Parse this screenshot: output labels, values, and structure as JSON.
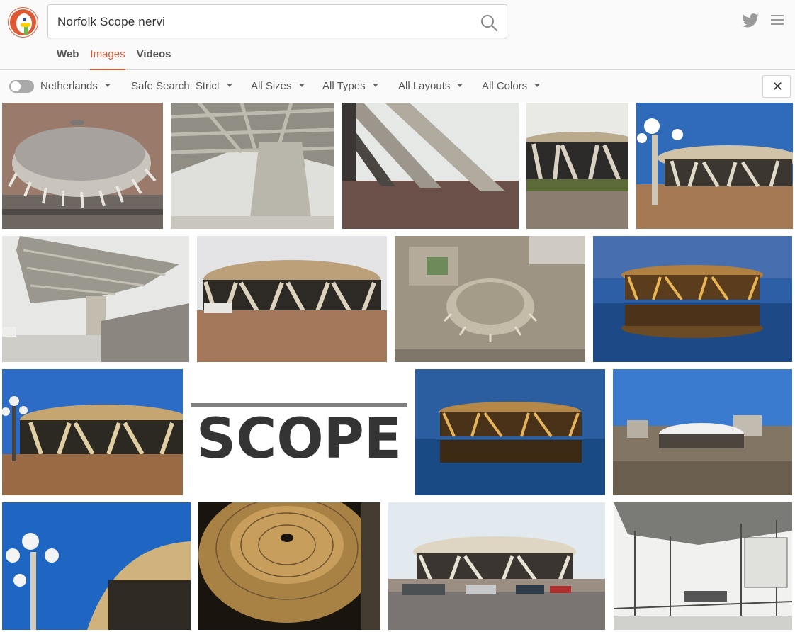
{
  "search": {
    "query": "Norfolk Scope nervi"
  },
  "tabs": [
    {
      "label": "Web"
    },
    {
      "label": "Images"
    },
    {
      "label": "Videos"
    }
  ],
  "filters": {
    "region": "Netherlands",
    "safe_search": "Safe Search: Strict",
    "sizes": "All Sizes",
    "types": "All Types",
    "layouts": "All Layouts",
    "colors": "All Colors"
  },
  "icons": {
    "logo": "duckduckgo-logo",
    "search": "search-icon",
    "twitter": "twitter-icon",
    "menu": "hamburger-menu-icon",
    "close": "close-icon"
  },
  "colors": {
    "accent": "#de5833",
    "twitter": "#9a9a9a"
  },
  "results": {
    "scope_logo_text": "SCOPE"
  }
}
